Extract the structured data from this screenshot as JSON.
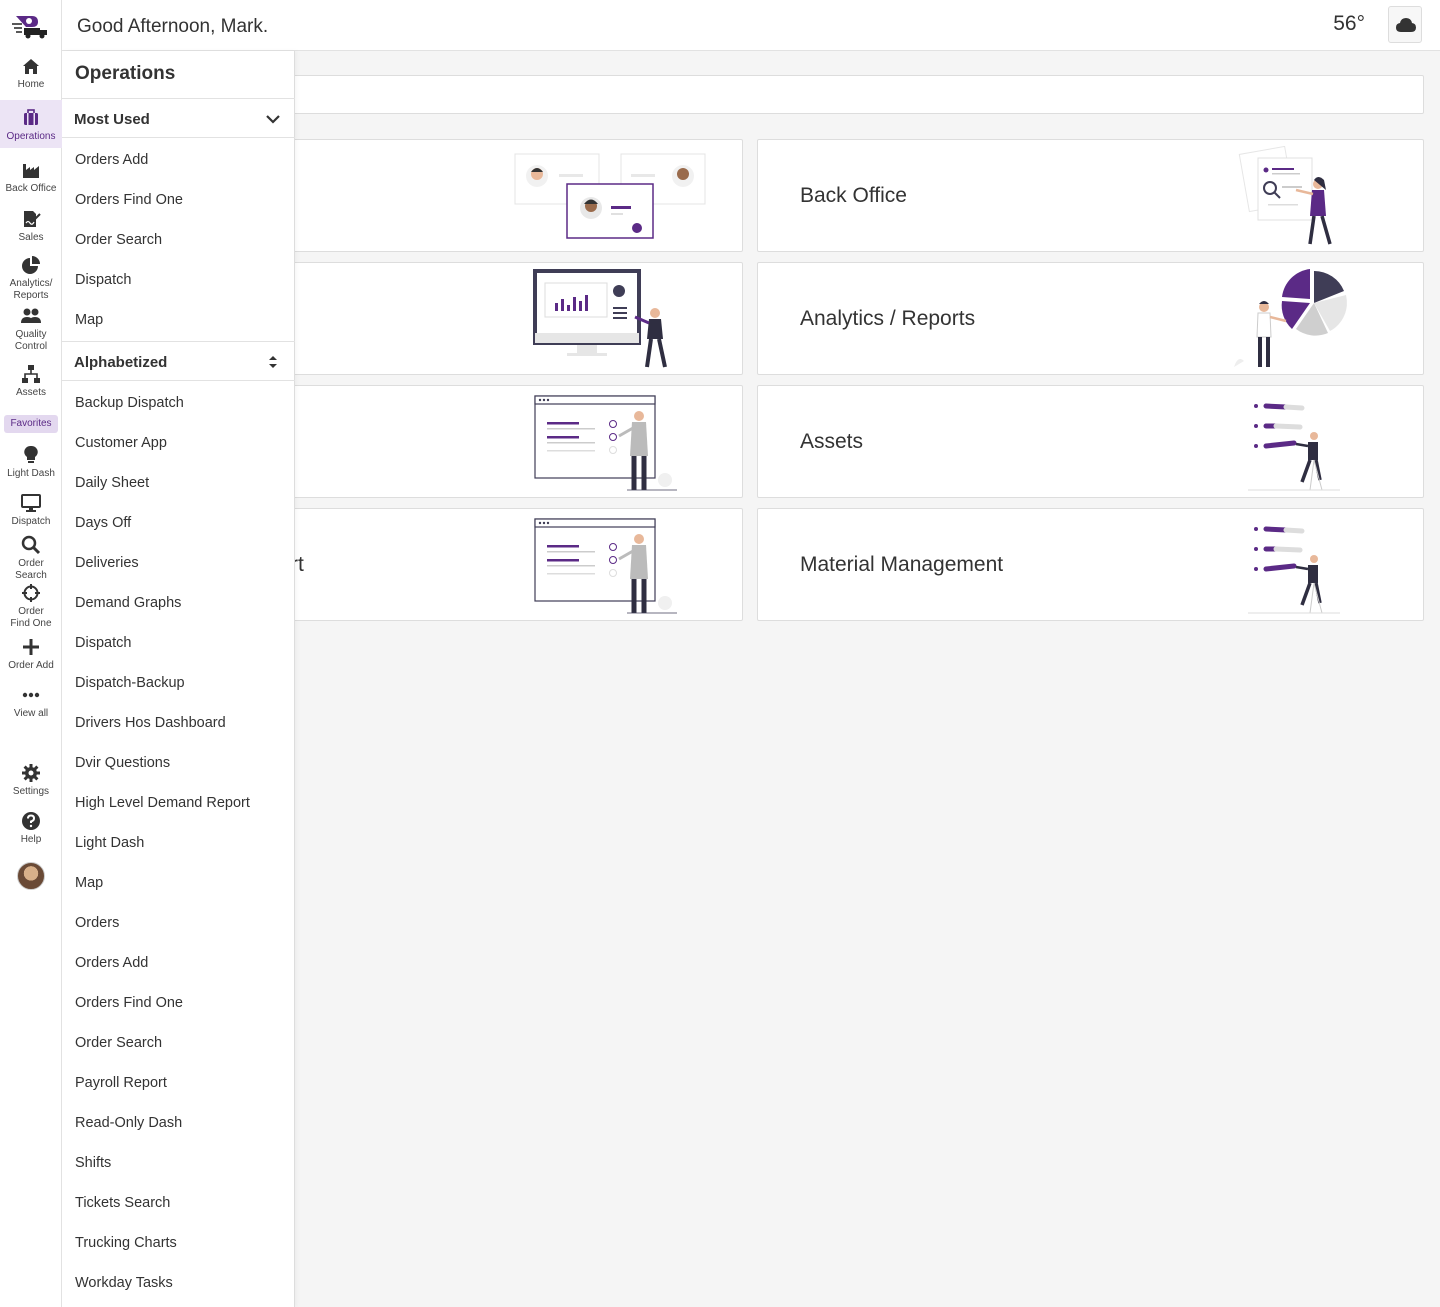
{
  "header": {
    "greeting": "Good Afternoon, Mark.",
    "temperature": "56°"
  },
  "rail": {
    "items": [
      {
        "label": "Home",
        "icon": "home-icon"
      },
      {
        "label": "Operations",
        "icon": "briefcase-icon"
      },
      {
        "label": "Back Office",
        "icon": "factory-icon"
      },
      {
        "label": "Sales",
        "icon": "file-signature-icon"
      },
      {
        "label1": "Analytics/",
        "label2": "Reports",
        "icon": "pie-chart-icon"
      },
      {
        "label1": "Quality",
        "label2": "Control",
        "icon": "users-icon"
      },
      {
        "label": "Assets",
        "icon": "sitemap-icon"
      }
    ],
    "favorites_label": "Favorites",
    "favorites": [
      {
        "label": "Light Dash",
        "icon": "lightbulb-icon"
      },
      {
        "label": "Dispatch",
        "icon": "monitor-icon"
      },
      {
        "label1": "Order",
        "label2": "Search",
        "icon": "search-icon"
      },
      {
        "label1": "Order",
        "label2": "Find One",
        "icon": "crosshair-icon"
      },
      {
        "label": "Order Add",
        "icon": "plus-icon"
      },
      {
        "label": "View all",
        "icon": "ellipsis-icon"
      }
    ],
    "settings_label": "Settings",
    "help_label": "Help"
  },
  "flyout": {
    "title": "Operations",
    "most_used_label": "Most Used",
    "most_used": [
      "Orders Add",
      "Orders Find One",
      "Order Search",
      "Dispatch",
      "Map"
    ],
    "alphabetized_label": "Alphabetized",
    "alphabetized": [
      "Backup Dispatch",
      "Customer App",
      "Daily Sheet",
      "Days Off",
      "Deliveries",
      "Demand Graphs",
      "Dispatch",
      "Dispatch-Backup",
      "Drivers Hos Dashboard",
      "Dvir Questions",
      "High Level Demand Report",
      "Light Dash",
      "Map",
      "Orders",
      "Orders Add",
      "Orders Find One",
      "Order Search",
      "Payroll Report",
      "Read-Only Dash",
      "Shifts",
      "Tickets Search",
      "Trucking Charts",
      "Workday Tasks"
    ]
  },
  "cards": {
    "right": [
      "Back Office",
      "Analytics / Reports",
      "Assets",
      "Material Management"
    ],
    "left_partial": [
      "",
      "",
      "",
      "rt"
    ]
  },
  "colors": {
    "accent": "#5b2a86",
    "accent_light": "#ece4f5"
  }
}
